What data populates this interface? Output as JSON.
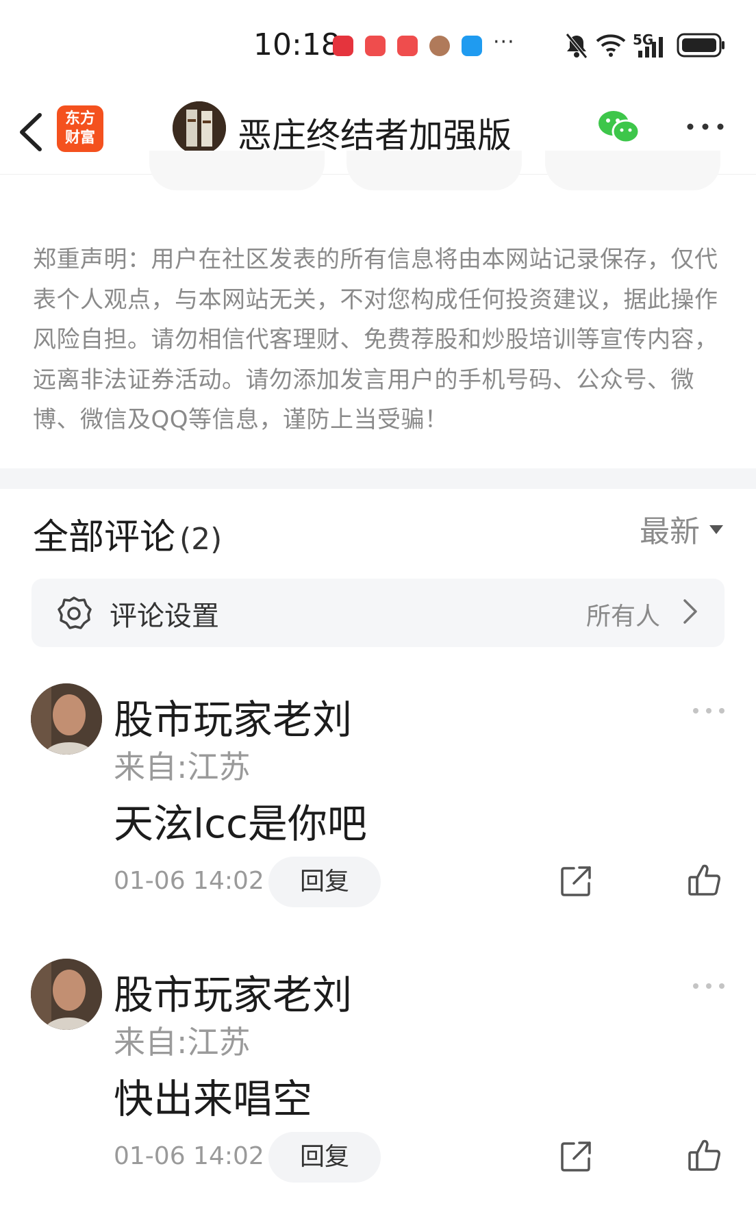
{
  "status_bar": {
    "time": "10:18",
    "network": "5G",
    "notification_more": "···",
    "icons": [
      "huawei-app-icon",
      "red-book-icon",
      "red-book-icon",
      "contact-avatar-icon",
      "message-bubble-icon",
      "bell-muted-icon",
      "wifi-icon",
      "signal-icon",
      "battery-icon"
    ]
  },
  "header": {
    "app_logo_line1": "东方",
    "app_logo_line2": "财富",
    "title": "恶庄终结者加强版",
    "accent_color": "#f4511e",
    "wechat_color": "#3dc64a"
  },
  "disclaimer": "郑重声明：用户在社区发表的所有信息将由本网站记录保存，仅代表个人观点，与本网站无关，不对您构成任何投资建议，据此操作风险自担。请勿相信代客理财、免费荐股和炒股培训等宣传内容，远离非法证券活动。请勿添加发言用户的手机号码、公众号、微博、微信及QQ等信息，谨防上当受骗！",
  "comments_section": {
    "title": "全部评论",
    "count": "(2)",
    "sort_label": "最新",
    "settings_label": "评论设置",
    "settings_value": "所有人"
  },
  "comments": [
    {
      "name": "股市玩家老刘",
      "location": "来自:江苏",
      "text": "天泫lcc是你吧",
      "time": "01-06 14:02",
      "reply_label": "回复"
    },
    {
      "name": "股市玩家老刘",
      "location": "来自:江苏",
      "text": "快出来唱空",
      "time": "01-06 14:02",
      "reply_label": "回复"
    }
  ]
}
